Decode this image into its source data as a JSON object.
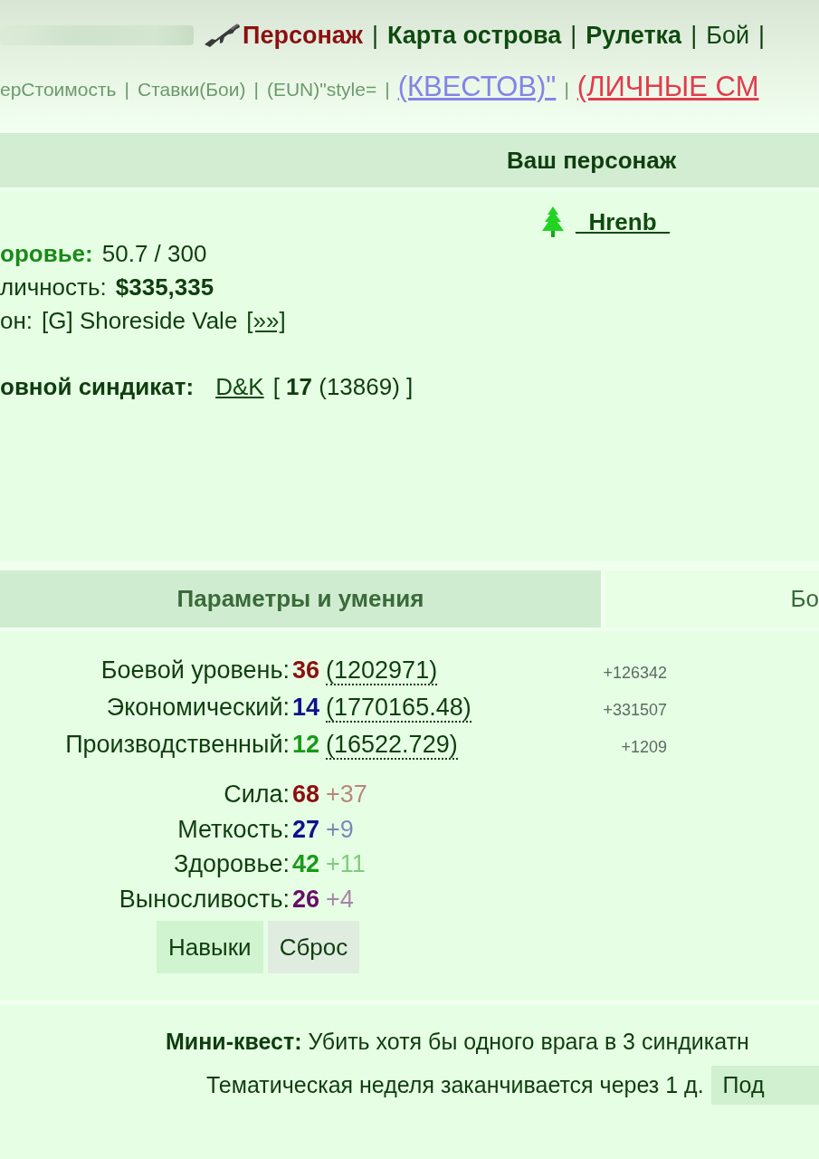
{
  "top_nav": {
    "items": [
      {
        "label": "Персонаж",
        "kind": "current"
      },
      {
        "label": "|",
        "kind": "separator"
      },
      {
        "label": "Карта острова",
        "kind": "bold"
      },
      {
        "label": "|",
        "kind": "separator"
      },
      {
        "label": "Рулетка",
        "kind": "bold"
      },
      {
        "label": "|",
        "kind": "separator"
      },
      {
        "label": "Бой",
        "kind": "plain"
      },
      {
        "label": "|",
        "kind": "separator"
      }
    ]
  },
  "sub_nav": {
    "items": [
      {
        "label": "ерСтоимость",
        "kind": "link"
      },
      {
        "label": "|",
        "kind": "separator"
      },
      {
        "label": "Ставки(Бои)",
        "kind": "link"
      },
      {
        "label": "|",
        "kind": "separator"
      },
      {
        "label": "(EUN)\"style=",
        "kind": "link"
      },
      {
        "label": "|",
        "kind": "separator"
      },
      {
        "label": "(КВЕСТОВ)\"",
        "kind": "quests"
      },
      {
        "label": "|",
        "kind": "separator"
      },
      {
        "label": "(ЛИЧНЫЕ СМ",
        "kind": "alert"
      }
    ]
  },
  "character": {
    "title": "Ваш персонаж",
    "name": "_Hrenb_",
    "lines": [
      {
        "kind": "health",
        "label": "оровье:",
        "value": "50.7 / 300"
      },
      {
        "kind": "money",
        "label": "личность:",
        "value": "$335,335"
      },
      {
        "kind": "region",
        "label": "он:",
        "value": "[G] Shoreside Vale",
        "link": "[»»]"
      },
      {
        "kind": "syndicate",
        "label": "овной синдикат:",
        "link": "D&K",
        "value": "[ **17** (13869) ]"
      }
    ]
  },
  "tabs": [
    {
      "label": "Параметры и умения",
      "selected": true
    },
    {
      "label": "Бо",
      "selected": false
    }
  ],
  "levels": [
    {
      "label": "Боевой уровень:",
      "value": "36",
      "experience": "(1202971)",
      "delta": "+126342",
      "color": "#8b1010"
    },
    {
      "label": "Экономический:",
      "value": "14",
      "experience": "(1770165.48)",
      "delta": "+331507",
      "color": "#10108b"
    },
    {
      "label": "Производственный:",
      "value": "12",
      "experience": "(16522.729)",
      "delta": "+1209",
      "color": "#199a19"
    }
  ],
  "attributes": [
    {
      "label": "Сила:",
      "value": "68",
      "bonus": "+37",
      "color": "#8b1010"
    },
    {
      "label": "Меткость:",
      "value": "27",
      "bonus": "+9",
      "color": "#10108b"
    },
    {
      "label": "Здоровье:",
      "value": "42",
      "bonus": "+11",
      "color": "#199a19"
    },
    {
      "label": "Выносливость:",
      "value": "26",
      "bonus": "+4",
      "color": "#660f66"
    }
  ],
  "buttons": [
    {
      "label": "Навыки",
      "kind": "primary"
    },
    {
      "label": "Сброс",
      "kind": "secondary"
    }
  ],
  "footer": {
    "mini_quest": "**Мини-квест:** Убить хотя бы одного врага в 3 синдикатн",
    "theme_week": "Тематическая неделя заканчивается через 1 д.",
    "button": "Под"
  }
}
